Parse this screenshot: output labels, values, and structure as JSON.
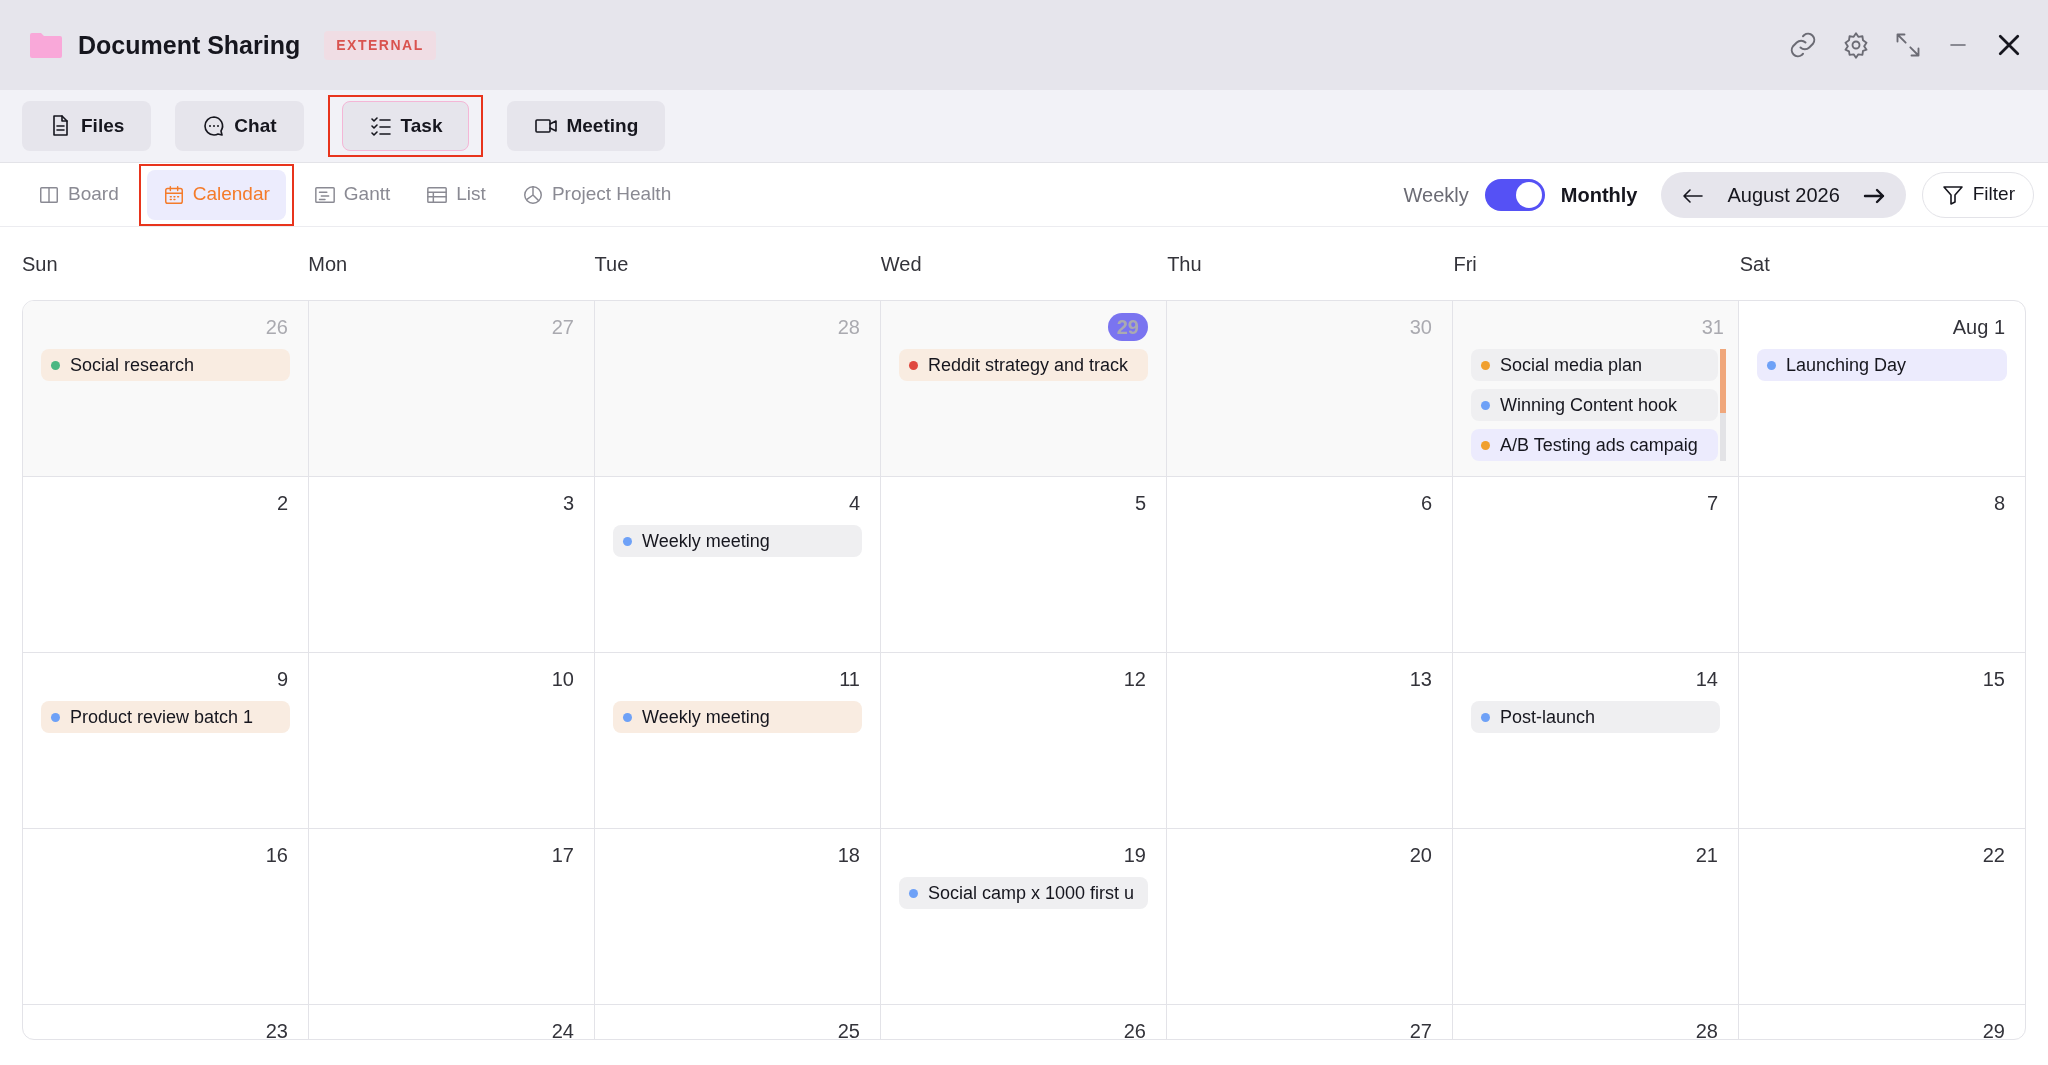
{
  "window": {
    "title": "Document Sharing",
    "badge": "EXTERNAL"
  },
  "tabs": [
    {
      "label": "Files",
      "selected": false
    },
    {
      "label": "Chat",
      "selected": false
    },
    {
      "label": "Task",
      "selected": true
    },
    {
      "label": "Meeting",
      "selected": false
    }
  ],
  "views": [
    {
      "label": "Board",
      "selected": false
    },
    {
      "label": "Calendar",
      "selected": true
    },
    {
      "label": "Gantt",
      "selected": false
    },
    {
      "label": "List",
      "selected": false
    },
    {
      "label": "Project Health",
      "selected": false
    }
  ],
  "range_toggle": {
    "left": "Weekly",
    "right": "Monthly",
    "on": true
  },
  "month": "August 2026",
  "filter": "Filter",
  "weekdays": [
    "Sun",
    "Mon",
    "Tue",
    "Wed",
    "Thu",
    "Fri",
    "Sat"
  ],
  "weeks": [
    {
      "days": [
        {
          "label": "26",
          "in_month": false,
          "today": false,
          "events": [
            {
              "title": "Social research",
              "color": "#4cb782",
              "kind": "peach"
            }
          ]
        },
        {
          "label": "27",
          "in_month": false,
          "today": false
        },
        {
          "label": "28",
          "in_month": false,
          "today": false
        },
        {
          "label": "29",
          "in_month": false,
          "today": true,
          "events": [
            {
              "title": "Reddit strategy and track",
              "color": "#e0483e",
              "kind": "peach"
            }
          ]
        },
        {
          "label": "30",
          "in_month": false,
          "today": false
        },
        {
          "label": "31",
          "in_month": false,
          "today": false,
          "scroll": true,
          "events": [
            {
              "title": "Social media plan",
              "color": "#f0a030",
              "kind": "grey"
            },
            {
              "title": "Winning Content hook",
              "color": "#6ea1f7",
              "kind": "grey"
            },
            {
              "title": "A/B Testing ads campaig",
              "color": "#f0a030",
              "kind": "lavender"
            }
          ]
        },
        {
          "label": "Aug 1",
          "in_month": true,
          "today": false,
          "events": [
            {
              "title": "Launching Day",
              "color": "#6ea1f7",
              "kind": "lavender"
            }
          ]
        }
      ]
    },
    {
      "days": [
        {
          "label": "2",
          "in_month": true,
          "today": false
        },
        {
          "label": "3",
          "in_month": true,
          "today": false
        },
        {
          "label": "4",
          "in_month": true,
          "today": false,
          "events": [
            {
              "title": "Weekly meeting",
              "color": "#6ea1f7",
              "kind": "grey"
            }
          ]
        },
        {
          "label": "5",
          "in_month": true,
          "today": false
        },
        {
          "label": "6",
          "in_month": true,
          "today": false
        },
        {
          "label": "7",
          "in_month": true,
          "today": false
        },
        {
          "label": "8",
          "in_month": true,
          "today": false
        }
      ]
    },
    {
      "days": [
        {
          "label": "9",
          "in_month": true,
          "today": false,
          "events": [
            {
              "title": "Product review batch 1",
              "color": "#6ea1f7",
              "kind": "peach"
            }
          ]
        },
        {
          "label": "10",
          "in_month": true,
          "today": false
        },
        {
          "label": "11",
          "in_month": true,
          "today": false,
          "events": [
            {
              "title": "Weekly meeting",
              "color": "#6ea1f7",
              "kind": "peach"
            }
          ]
        },
        {
          "label": "12",
          "in_month": true,
          "today": false
        },
        {
          "label": "13",
          "in_month": true,
          "today": false
        },
        {
          "label": "14",
          "in_month": true,
          "today": false,
          "events": [
            {
              "title": "Post-launch",
              "color": "#6ea1f7",
              "kind": "grey"
            }
          ]
        },
        {
          "label": "15",
          "in_month": true,
          "today": false
        }
      ]
    },
    {
      "days": [
        {
          "label": "16",
          "in_month": true,
          "today": false
        },
        {
          "label": "17",
          "in_month": true,
          "today": false
        },
        {
          "label": "18",
          "in_month": true,
          "today": false
        },
        {
          "label": "19",
          "in_month": true,
          "today": false,
          "events": [
            {
              "title": "Social camp x 1000 first u",
              "color": "#6ea1f7",
              "kind": "grey"
            }
          ]
        },
        {
          "label": "20",
          "in_month": true,
          "today": false
        },
        {
          "label": "21",
          "in_month": true,
          "today": false
        },
        {
          "label": "22",
          "in_month": true,
          "today": false
        }
      ]
    },
    {
      "days": [
        {
          "label": "23",
          "in_month": true,
          "today": false
        },
        {
          "label": "24",
          "in_month": true,
          "today": false
        },
        {
          "label": "25",
          "in_month": true,
          "today": false
        },
        {
          "label": "26",
          "in_month": true,
          "today": false
        },
        {
          "label": "27",
          "in_month": true,
          "today": false
        },
        {
          "label": "28",
          "in_month": true,
          "today": false
        },
        {
          "label": "29",
          "in_month": true,
          "today": false
        }
      ]
    }
  ]
}
